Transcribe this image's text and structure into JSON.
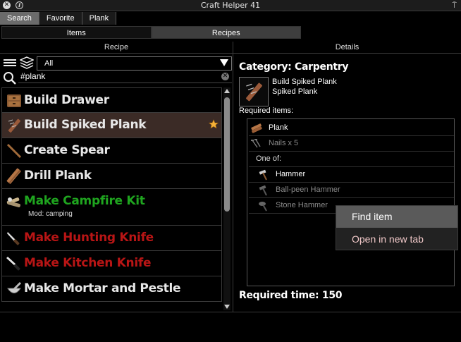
{
  "window": {
    "title": "Craft Helper 41"
  },
  "top_tabs": [
    {
      "label": "Search",
      "active": true
    },
    {
      "label": "Favorite",
      "active": false
    },
    {
      "label": "Plank",
      "active": false
    }
  ],
  "sub_tabs": [
    {
      "label": "Items",
      "active": false
    },
    {
      "label": "Recipes",
      "active": true
    }
  ],
  "left_header": "Recipe",
  "right_header": "Details",
  "filter": {
    "category_selected": "All"
  },
  "search": {
    "value": "#plank"
  },
  "recipes": [
    {
      "name": "Build Drawer",
      "color": "#e8e8e8",
      "icon": "drawer-icon"
    },
    {
      "name": "Build Spiked Plank",
      "color": "#e8e8e8",
      "icon": "spiked-plank-icon",
      "selected": true,
      "favorite": true
    },
    {
      "name": "Create Spear",
      "color": "#e8e8e8",
      "icon": "spear-icon"
    },
    {
      "name": "Drill Plank",
      "color": "#e8e8e8",
      "icon": "plank-icon"
    },
    {
      "name": "Make Campfire Kit",
      "color": "#1fa51f",
      "icon": "campfire-kit-icon",
      "mod": "Mod: camping"
    },
    {
      "name": "Make Hunting Knife",
      "color": "#b81515",
      "icon": "hunting-knife-icon"
    },
    {
      "name": "Make Kitchen Knife",
      "color": "#b81515",
      "icon": "kitchen-knife-icon"
    },
    {
      "name": "Make Mortar and Pestle",
      "color": "#e8e8e8",
      "icon": "mortar-pestle-icon"
    }
  ],
  "details": {
    "category": "Category: Carpentry",
    "result_lines": [
      "Build Spiked Plank",
      "Spiked Plank"
    ],
    "required_label": "Required items:",
    "required_items": [
      {
        "label": "Plank",
        "dim": false,
        "icon": "plank-icon"
      },
      {
        "label": "Nails x 5",
        "dim": true,
        "icon": "nails-icon"
      }
    ],
    "one_of_label": "One of:",
    "one_of_items": [
      {
        "label": "Hammer",
        "dim": false,
        "icon": "hammer-icon"
      },
      {
        "label": "Ball-peen Hammer",
        "dim": true,
        "icon": "ball-peen-hammer-icon"
      },
      {
        "label": "Stone Hammer",
        "dim": true,
        "icon": "stone-hammer-icon"
      }
    ],
    "required_time": "Required time: 150"
  },
  "context_menu": {
    "items": [
      "Find item",
      "Open in new tab"
    ]
  },
  "colors": {
    "accent_selected_row": "#3b2b26",
    "available": "#1fa51f",
    "unavailable": "#b81515",
    "favorite_star": "#f4b23a"
  }
}
